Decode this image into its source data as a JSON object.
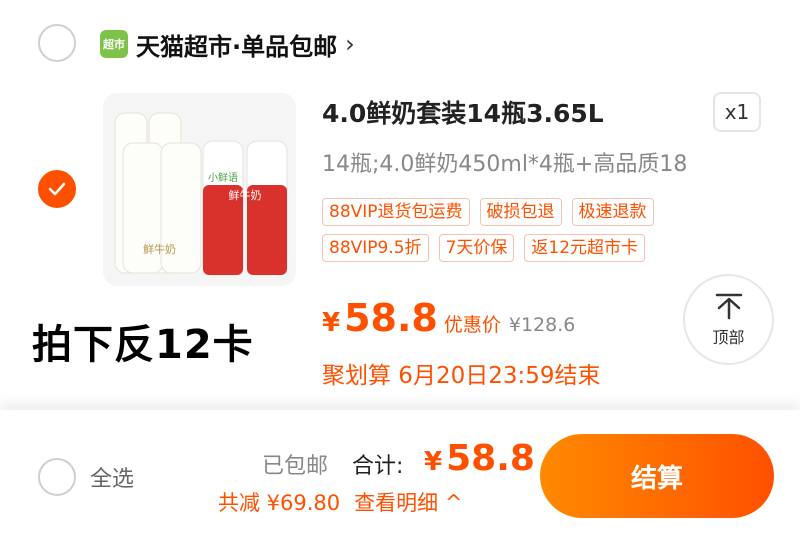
{
  "store": {
    "logo_text": "超市",
    "name": "天猫超市·单品包邮",
    "chevron": "›"
  },
  "item": {
    "title": "4.0鲜奶套装14瓶3.65L",
    "quantity": "x1",
    "spec": "14瓶;4.0鲜奶450ml*4瓶+高品质18",
    "tags": [
      "88VIP退货包运费",
      "破损包退",
      "极速退款",
      "88VIP9.5折",
      "7天价保",
      "返12元超市卡"
    ],
    "price_symbol": "¥",
    "price": "58.8",
    "price_label": "优惠价",
    "original_price": "¥128.6",
    "promo": "聚划算 6月20日23:59结束",
    "image": {
      "label_left": "鲜牛奶",
      "label_right_1": "小鲜语",
      "label_right_2": "鲜牛奶"
    }
  },
  "overlay_text": "拍下反12卡",
  "back_to_top": {
    "label": "顶部"
  },
  "footer": {
    "select_all": "全选",
    "shipping": "已包邮",
    "total_label": "合计:",
    "total_symbol": "¥",
    "total": "58.8",
    "discount": "共减 ¥69.80",
    "details": "查看明细 ^",
    "checkout": "结算"
  },
  "colors": {
    "accent": "#ff5000",
    "green": "#7ec24a"
  }
}
